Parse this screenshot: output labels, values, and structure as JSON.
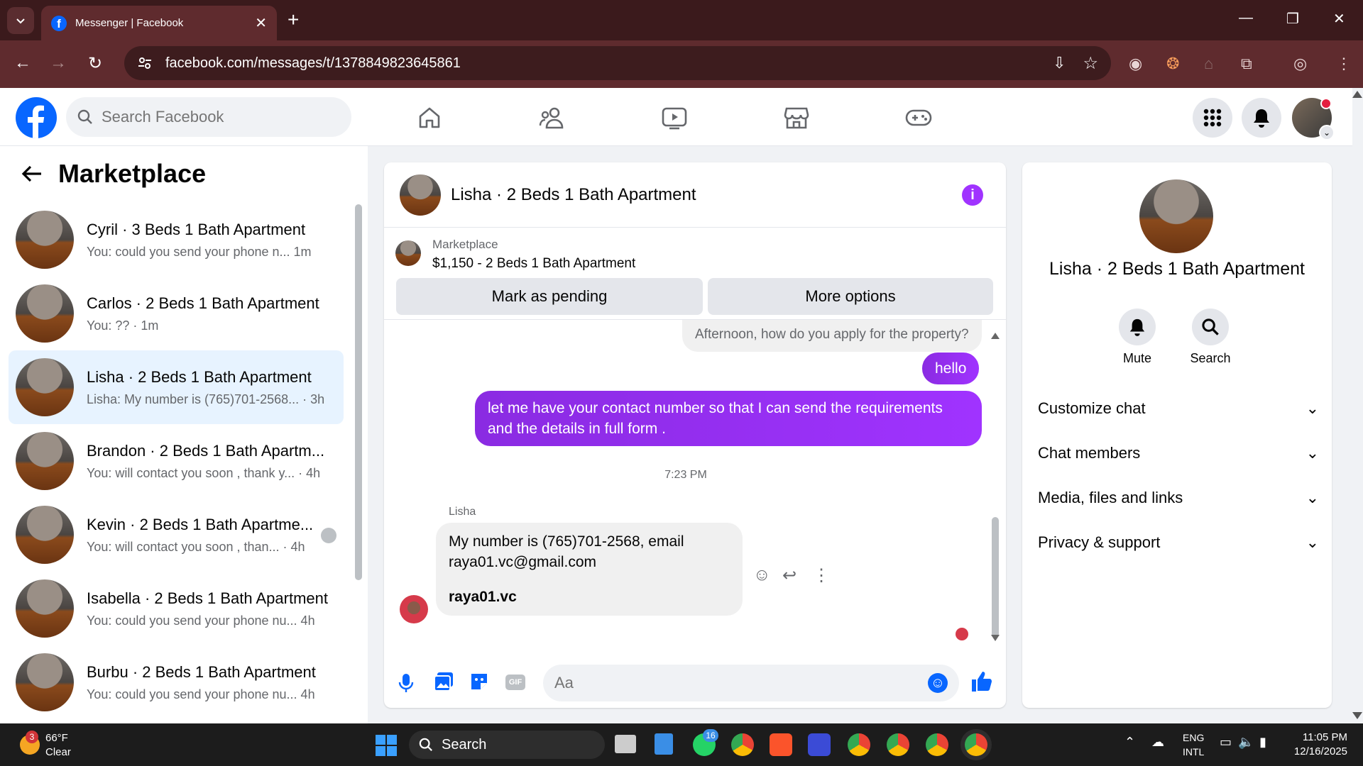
{
  "browser": {
    "tab_title": "Messenger | Facebook",
    "url": "facebook.com/messages/t/1378849823645861"
  },
  "fb": {
    "search_placeholder": "Search Facebook",
    "nav_icons": [
      "home-icon",
      "friends-icon",
      "video-icon",
      "marketplace-icon",
      "gaming-icon"
    ]
  },
  "left": {
    "title": "Marketplace",
    "conversations": [
      {
        "name": "Cyril · 3 Beds 1 Bath Apartment",
        "preview": "You: could you send your phone n...  1m"
      },
      {
        "name": "Carlos · 2 Beds 1 Bath Apartment",
        "preview": "You: ?? · 1m"
      },
      {
        "name": "Lisha · 2 Beds 1 Bath Apartment",
        "preview": "Lisha: My number is (765)701-2568... · 3h"
      },
      {
        "name": "Brandon · 2 Beds 1 Bath Apartm...",
        "preview": "You: will contact you soon , thank y... · 4h"
      },
      {
        "name": "Kevin · 2 Beds 1 Bath Apartme...",
        "preview": "You: will contact you soon , than... · 4h"
      },
      {
        "name": "Isabella · 2 Beds 1 Bath Apartment",
        "preview": "You: could you send your phone nu...  4h"
      },
      {
        "name": "Burbu · 2 Beds 1 Bath Apartment",
        "preview": "You: could you send your phone nu...  4h"
      }
    ]
  },
  "chat": {
    "title": "Lisha · 2 Beds 1 Bath Apartment",
    "marketplace_label": "Marketplace",
    "listing": "$1,150 - 2 Beds 1 Bath Apartment",
    "mark_pending": "Mark as pending",
    "more_options": "More options",
    "msg_prev": "Afternoon, how do you apply for the property?",
    "msg_hello": "hello",
    "msg_contact": "let me have your contact number so that I can send the requirements and the details in full form .",
    "timestamp": "7:23 PM",
    "sender": "Lisha",
    "msg_in_line1": "My number is (765)701-2568, email raya01.vc@gmail.com",
    "msg_in_line2": "raya01.vc",
    "composer_placeholder": "Aa"
  },
  "right": {
    "name": "Lisha · 2 Beds 1 Bath Apartment",
    "mute": "Mute",
    "search": "Search",
    "sections": [
      "Customize chat",
      "Chat members",
      "Media, files and links",
      "Privacy & support"
    ]
  },
  "taskbar": {
    "weather_temp": "66°F",
    "weather_desc": "Clear",
    "weather_badge": "3",
    "search": "Search",
    "whatsapp_badge": "16",
    "lang1": "ENG",
    "lang2": "INTL",
    "time": "11:05 PM",
    "date": "12/16/2025"
  },
  "colors": {
    "fb_blue": "#0866ff",
    "messenger_purple": "#a033ff",
    "browser_frame": "#5f2b2e"
  }
}
